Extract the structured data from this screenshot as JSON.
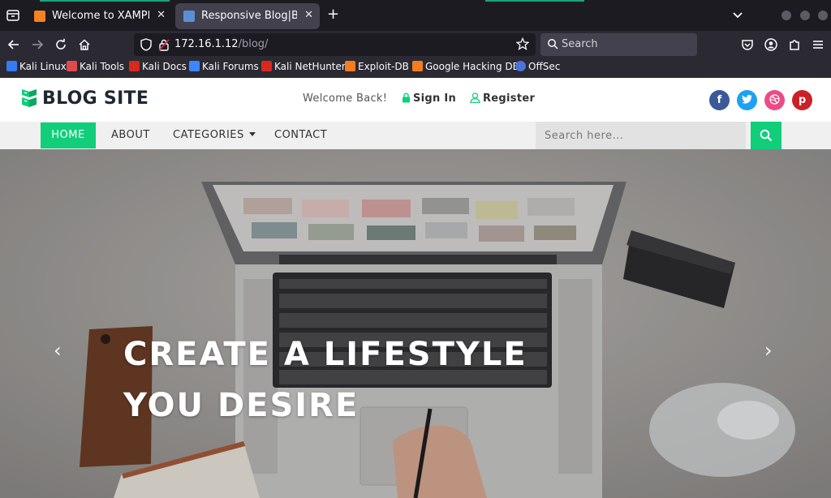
{
  "browser": {
    "tabs": [
      {
        "title": "Welcome to XAMPP",
        "favicon_color": "#f58220",
        "active": false
      },
      {
        "title": "Responsive Blog|Blogging",
        "favicon_color": "#5a8fd6",
        "active": true
      }
    ],
    "url_host": "172.16.1.12",
    "url_path": "/blog/",
    "search_placeholder": "Search",
    "bookmarks": [
      {
        "label": "Kali Linux",
        "icon": "kali-dragon-icon",
        "color": "#367bf0"
      },
      {
        "label": "Kali Tools",
        "icon": "kali-tools-icon",
        "color": "#e04a4a"
      },
      {
        "label": "Kali Docs",
        "icon": "kali-docs-icon",
        "color": "#d9281e"
      },
      {
        "label": "Kali Forums",
        "icon": "kali-forums-icon",
        "color": "#3a86ff"
      },
      {
        "label": "Kali NetHunter",
        "icon": "nethunter-icon",
        "color": "#d9281e"
      },
      {
        "label": "Exploit-DB",
        "icon": "exploit-db-icon",
        "color": "#f57c1f"
      },
      {
        "label": "Google Hacking DB",
        "icon": "ghdb-icon",
        "color": "#f57c1f"
      },
      {
        "label": "OffSec",
        "icon": "offsec-icon",
        "color": "#4a74d8"
      }
    ]
  },
  "site": {
    "logo_text": "BLOG SITE",
    "welcome": "Welcome Back!",
    "signin": "Sign In",
    "register": "Register",
    "accent": "#10ce7a",
    "social": [
      {
        "name": "facebook-icon",
        "glyph": "f",
        "color": "#3b5998"
      },
      {
        "name": "twitter-icon",
        "glyph": "t",
        "color": "#1da1f2"
      },
      {
        "name": "dribbble-icon",
        "glyph": "◎",
        "color": "#ea4c89"
      },
      {
        "name": "pinterest-icon",
        "glyph": "p",
        "color": "#cb2027"
      }
    ],
    "menu": {
      "home": "HOME",
      "about": "ABOUT",
      "categories": "CATEGORIES",
      "contact": "CONTACT"
    },
    "search_placeholder": "Search here...",
    "hero": {
      "line1": "CREATE A LIFESTYLE",
      "line2": "YOU DESIRE",
      "prev": "‹",
      "next": "›"
    }
  }
}
